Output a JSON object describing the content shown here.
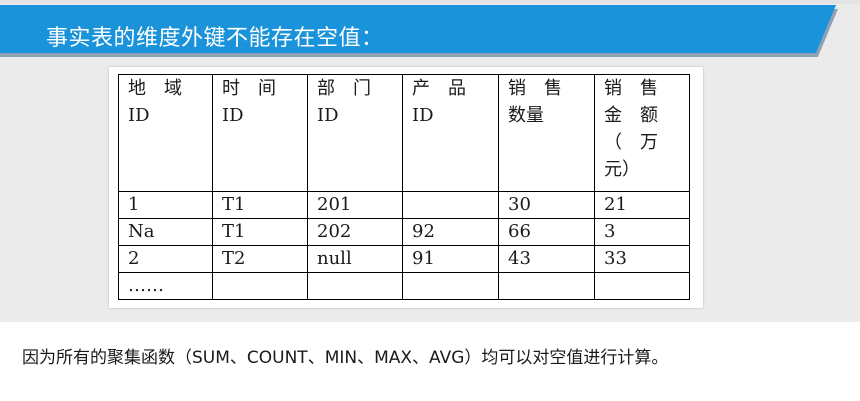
{
  "banner": {
    "title": "事实表的维度外键不能存在空值："
  },
  "table": {
    "headers": [
      [
        "地　域",
        "ID"
      ],
      [
        "时　间",
        "ID"
      ],
      [
        "部　门",
        "ID"
      ],
      [
        "产　品",
        "ID"
      ],
      [
        "销　售",
        "数量"
      ],
      [
        "销　售",
        "金　额",
        "（　万",
        "元）"
      ]
    ],
    "rows": [
      [
        "1",
        "T1",
        "201",
        "",
        "30",
        "21"
      ],
      [
        "Na",
        "T1",
        "202",
        "92",
        "66",
        "3"
      ],
      [
        "2",
        "T2",
        "null",
        "91",
        "43",
        "33"
      ],
      [
        "……",
        "",
        "",
        "",
        "",
        ""
      ]
    ]
  },
  "caption": {
    "text": "因为所有的聚集函数（SUM、COUNT、MIN、MAX、AVG）均可以对空值进行计算。"
  }
}
